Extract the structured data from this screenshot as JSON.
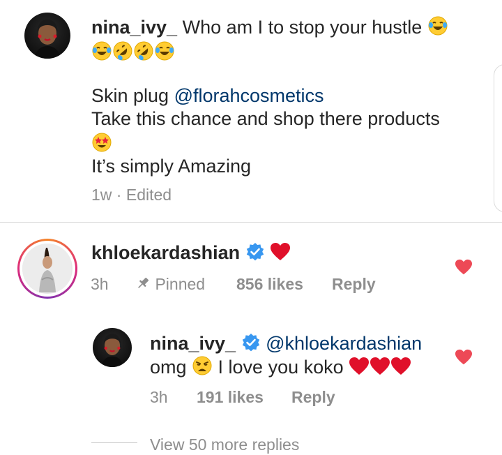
{
  "comment1": {
    "username": "nina_ivy_",
    "text_line1": "Who am I to stop your hustle",
    "emoji_line": [
      "laugh-tears",
      "rofl",
      "rofl",
      "laugh-tears"
    ],
    "line_skin": "Skin plug ",
    "mention": "@florahcosmetics",
    "line_take": "Take this chance and shop there products",
    "emoji_star": "star-struck",
    "line_amazing": "It’s simply Amazing",
    "time": "1w",
    "sep": "·",
    "edited": "Edited"
  },
  "comment2": {
    "username": "khloekardashian",
    "verified": true,
    "emoji": "red-heart",
    "time": "3h",
    "pinned": "Pinned",
    "likes": "856 likes",
    "reply": "Reply",
    "liked": true
  },
  "reply1": {
    "username": "nina_ivy_",
    "verified": true,
    "mention": "@khloekardashian",
    "text_pre": "omg ",
    "text_post": " I love you koko ",
    "time": "3h",
    "likes": "191 likes",
    "reply": "Reply",
    "liked": true
  },
  "view_more": "View 50 more replies",
  "colors": {
    "heart": "#ed4956",
    "verified": "#3897f0",
    "mention": "#00376b",
    "muted": "#8e8e8e"
  }
}
